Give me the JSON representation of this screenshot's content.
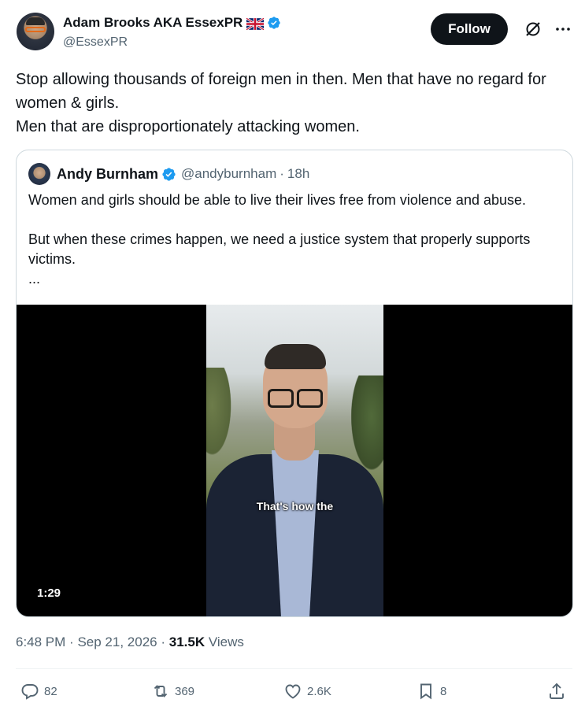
{
  "author": {
    "display_name": "Adam Brooks AKA EssexPR",
    "handle": "@EssexPR",
    "verified": true,
    "flag": "uk-flag-icon"
  },
  "follow_label": "Follow",
  "tweet": {
    "text": "Stop allowing thousands of foreign men in then. Men that have no regard for women & girls.\nMen that are disproportionately attacking women."
  },
  "quote": {
    "display_name": "Andy Burnham",
    "handle": "@andyburnham",
    "separator": "·",
    "time": "18h",
    "text": "Women and girls should be able to live their lives free from violence and abuse.\n\nBut when these crimes happen, we need a justice system that properly supports victims.\n...",
    "video": {
      "caption": "That's how the",
      "duration": "1:29"
    }
  },
  "meta": {
    "time": "6:48 PM",
    "sep1": "·",
    "date": "Sep 21, 2026",
    "sep2": "·",
    "views_count": "31.5K",
    "views_label": "Views"
  },
  "actions": {
    "replies": "82",
    "reposts": "369",
    "likes": "2.6K",
    "bookmarks": "8"
  },
  "colors": {
    "text": "#0f1419",
    "secondary": "#536471",
    "verified_blue": "#1d9bf0",
    "border": "#cfd9de"
  }
}
